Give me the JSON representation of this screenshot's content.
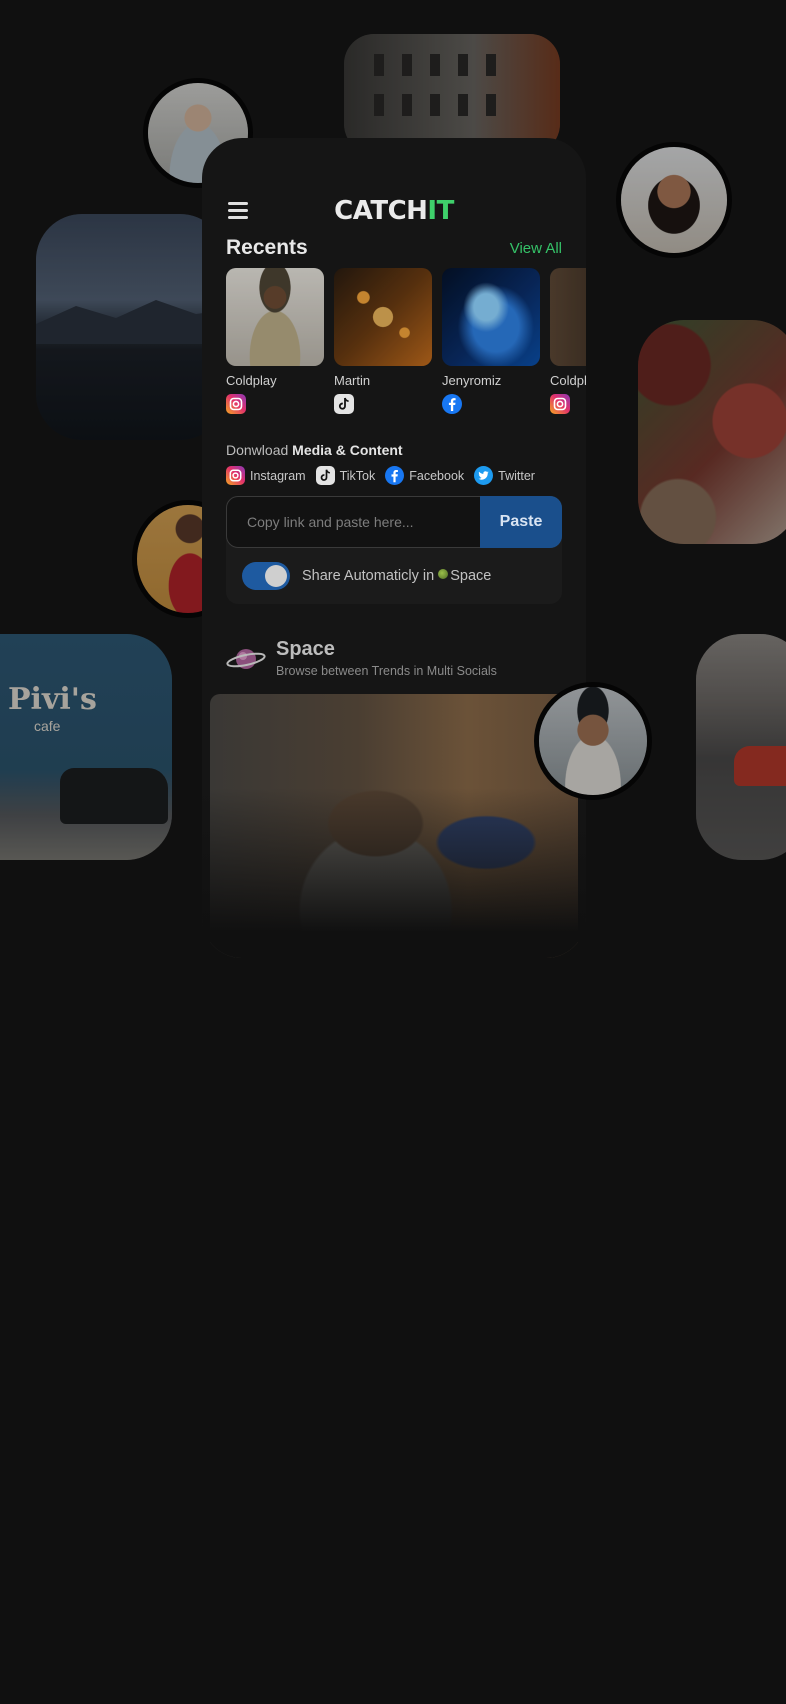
{
  "app": {
    "logo_main": "CATCH",
    "logo_accent": "IT",
    "accent_color": "#3fd06b",
    "brand_blue": "#1a4f8c"
  },
  "recents": {
    "title": "Recents",
    "view_all": "View All",
    "items": [
      {
        "name": "Coldplay",
        "platform": "instagram-icon"
      },
      {
        "name": "Martin",
        "platform": "tiktok-icon"
      },
      {
        "name": "Jenyromiz",
        "platform": "facebook-icon"
      },
      {
        "name": "Coldplay",
        "platform": "instagram-icon"
      }
    ]
  },
  "download": {
    "title_prefix": "Donwload ",
    "title_bold": "Media & Content",
    "platforms": [
      "Instagram",
      "TikTok",
      "Facebook",
      "Twitter"
    ],
    "input_placeholder": "Copy link and paste here...",
    "paste_label": "Paste",
    "auto_share_label": "Share Automaticly in ",
    "auto_share_target": "Space",
    "auto_share_on": true
  },
  "space": {
    "title": "Space",
    "subtitle": "Browse between Trends in Multi Socials"
  },
  "background_photos": {
    "cafe_sign": "Pivi's",
    "cafe_sub": "cafe"
  }
}
